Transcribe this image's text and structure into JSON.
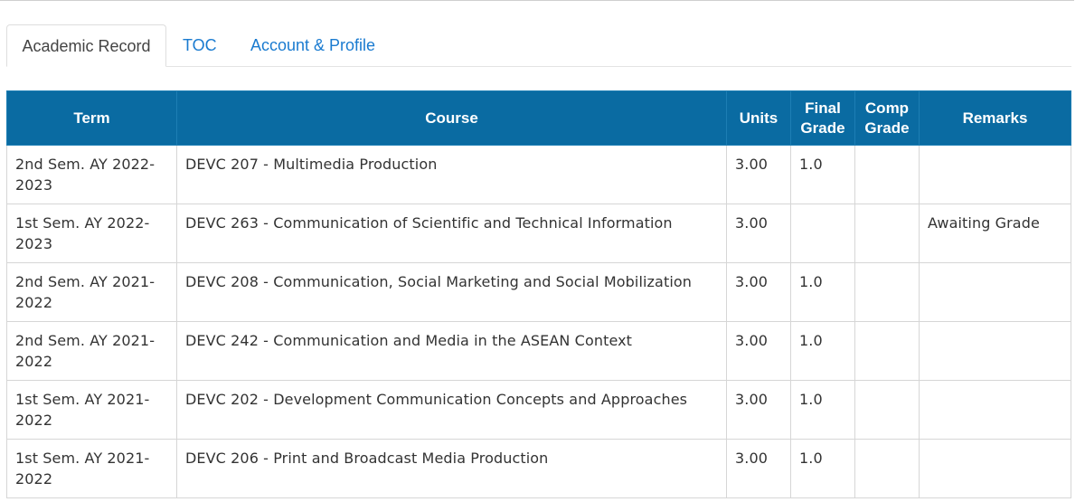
{
  "tabs": [
    {
      "label": "Academic Record",
      "active": true
    },
    {
      "label": "TOC",
      "active": false
    },
    {
      "label": "Account & Profile",
      "active": false
    }
  ],
  "table": {
    "headers": {
      "term": "Term",
      "course": "Course",
      "units": "Units",
      "final_grade": "Final Grade",
      "comp_grade": "Comp Grade",
      "remarks": "Remarks"
    },
    "header_color": "#0a6ba2",
    "rows": [
      {
        "term": "2nd Sem. AY 2022-2023",
        "course": "DEVC 207 - Multimedia Production",
        "units": "3.00",
        "final_grade": "1.0",
        "comp_grade": "",
        "remarks": ""
      },
      {
        "term": "1st Sem. AY 2022-2023",
        "course": "DEVC 263 - Communication of Scientific and Technical Information",
        "units": "3.00",
        "final_grade": "",
        "comp_grade": "",
        "remarks": "Awaiting Grade"
      },
      {
        "term": "2nd Sem. AY 2021-2022",
        "course": "DEVC 208 - Communication, Social Marketing and Social Mobilization",
        "units": "3.00",
        "final_grade": "1.0",
        "comp_grade": "",
        "remarks": ""
      },
      {
        "term": "2nd Sem. AY 2021-2022",
        "course": "DEVC 242 - Communication and Media in the ASEAN Context",
        "units": "3.00",
        "final_grade": "1.0",
        "comp_grade": "",
        "remarks": ""
      },
      {
        "term": "1st Sem. AY 2021-2022",
        "course": "DEVC 202 - Development Communication Concepts and Approaches",
        "units": "3.00",
        "final_grade": "1.0",
        "comp_grade": "",
        "remarks": ""
      },
      {
        "term": "1st Sem. AY 2021-2022",
        "course": "DEVC 206 - Print and Broadcast Media Production",
        "units": "3.00",
        "final_grade": "1.0",
        "comp_grade": "",
        "remarks": ""
      }
    ]
  }
}
